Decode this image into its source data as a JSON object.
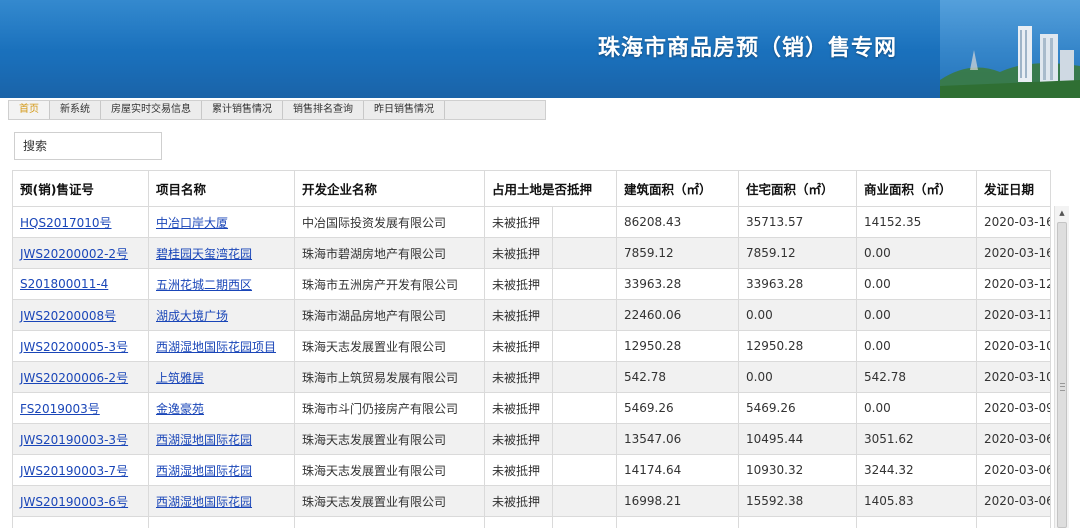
{
  "banner": {
    "title": "珠海市商品房预（销）售专网"
  },
  "nav": {
    "items": [
      {
        "label": "首页",
        "active": true
      },
      {
        "label": "新系统",
        "active": false
      },
      {
        "label": "房屋实时交易信息",
        "active": false
      },
      {
        "label": "累计销售情况",
        "active": false
      },
      {
        "label": "销售排名查询",
        "active": false
      },
      {
        "label": "昨日销售情况",
        "active": false
      }
    ]
  },
  "search": {
    "placeholder": "搜索"
  },
  "table": {
    "headers": [
      "预(销)售证号",
      "项目名称",
      "开发企业名称",
      "占用土地是否抵押",
      "建筑面积（㎡）",
      "住宅面积（㎡）",
      "商业面积（㎡）",
      "发证日期"
    ],
    "rows": [
      [
        "HQS2017010号",
        "中冶口岸大厦",
        "中冶国际投资发展有限公司",
        "未被抵押",
        "86208.43",
        "35713.57",
        "14152.35",
        "2020-03-16"
      ],
      [
        "JWS20200002-2号",
        "碧桂园天玺湾花园",
        "珠海市碧湖房地产有限公司",
        "未被抵押",
        "7859.12",
        "7859.12",
        "0.00",
        "2020-03-16"
      ],
      [
        "S201800011-4",
        "五洲花城二期西区",
        "珠海市五洲房产开发有限公司",
        "未被抵押",
        "33963.28",
        "33963.28",
        "0.00",
        "2020-03-12"
      ],
      [
        "JWS20200008号",
        "湖成大境广场",
        "珠海市湖品房地产有限公司",
        "未被抵押",
        "22460.06",
        "0.00",
        "0.00",
        "2020-03-11"
      ],
      [
        "JWS20200005-3号",
        "西湖湿地国际花园项目",
        "珠海天志发展置业有限公司",
        "未被抵押",
        "12950.28",
        "12950.28",
        "0.00",
        "2020-03-10"
      ],
      [
        "JWS20200006-2号",
        "上筑雅居",
        "珠海市上筑贸易发展有限公司",
        "未被抵押",
        "542.78",
        "0.00",
        "542.78",
        "2020-03-10"
      ],
      [
        "FS2019003号",
        "金逸豪苑",
        "珠海市斗门仍接房产有限公司",
        "未被抵押",
        "5469.26",
        "5469.26",
        "0.00",
        "2020-03-09"
      ],
      [
        "JWS20190003-3号",
        "西湖湿地国际花园",
        "珠海天志发展置业有限公司",
        "未被抵押",
        "13547.06",
        "10495.44",
        "3051.62",
        "2020-03-06"
      ],
      [
        "JWS20190003-7号",
        "西湖湿地国际花园",
        "珠海天志发展置业有限公司",
        "未被抵押",
        "14174.64",
        "10930.32",
        "3244.32",
        "2020-03-06"
      ],
      [
        "JWS20190003-6号",
        "西湖湿地国际花园",
        "珠海天志发展置业有限公司",
        "未被抵押",
        "16998.21",
        "15592.38",
        "1405.83",
        "2020-03-06"
      ],
      [
        "",
        "",
        "",
        "",
        "",
        "",
        "",
        ""
      ]
    ]
  },
  "colors": {
    "banner": "#1a6fba",
    "nav_active": "#d49a1a",
    "link": "#1a46b8"
  }
}
